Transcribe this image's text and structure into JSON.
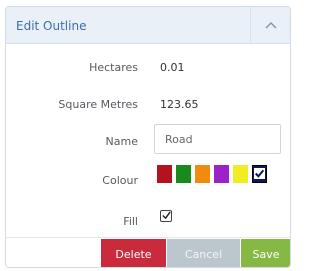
{
  "panel": {
    "title": "Edit Outline",
    "collapse_icon": "chevron-up-icon"
  },
  "fields": {
    "hectares": {
      "label": "Hectares",
      "value": "0.01"
    },
    "square_metres": {
      "label": "Square Metres",
      "value": "123.65"
    },
    "name": {
      "label": "Name",
      "value": "Road"
    },
    "colour": {
      "label": "Colour",
      "options": [
        "#b3121e",
        "#1a8a1a",
        "#f08a10",
        "#9a22c8",
        "#f2ec22",
        "#10185a"
      ],
      "selected": "#10185a"
    },
    "fill": {
      "label": "Fill",
      "checked": true
    }
  },
  "buttons": {
    "delete": "Delete",
    "cancel": "Cancel",
    "save": "Save"
  }
}
